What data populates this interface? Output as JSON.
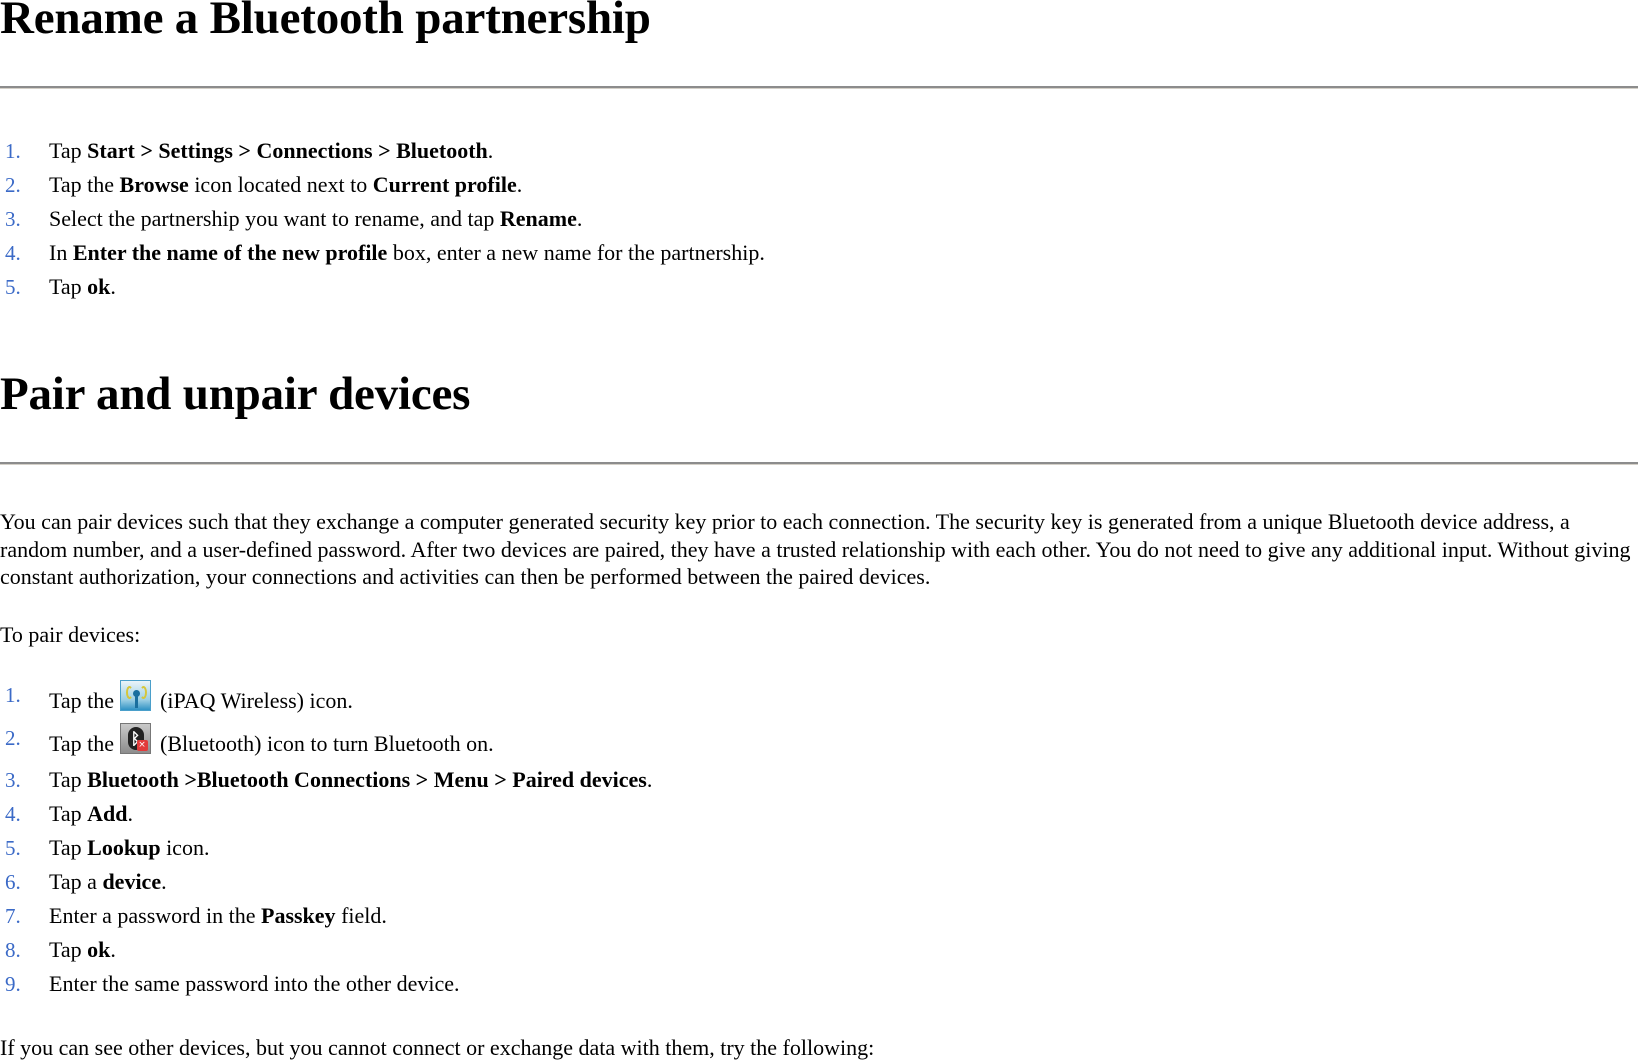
{
  "section1": {
    "title": "Rename a Bluetooth partnership",
    "steps": [
      {
        "num": "1.",
        "parts": [
          "Tap ",
          "Start > Settings > Connections > Bluetooth",
          "."
        ]
      },
      {
        "num": "2.",
        "parts": [
          "Tap the ",
          "Browse",
          " icon located next to ",
          "Current profile",
          "."
        ]
      },
      {
        "num": "3.",
        "parts": [
          "Select the partnership you want to rename, and tap ",
          "Rename",
          "."
        ]
      },
      {
        "num": "4.",
        "parts": [
          "In ",
          "Enter the name of the new profile",
          " box, enter a new name for the partnership."
        ]
      },
      {
        "num": "5.",
        "parts": [
          "Tap ",
          "ok",
          "."
        ]
      }
    ]
  },
  "section2": {
    "title": "Pair and unpair devices",
    "intro": "You can pair devices such that they exchange a computer generated security key prior to each connection. The security key is generated from a unique Bluetooth device address, a random number, and a user-defined password. After two devices are paired, they have a trusted relationship with each other. You do not need to give any additional input. Without giving constant authorization, your connections and activities can then be performed between the paired devices.",
    "to_pair": "To pair devices:",
    "steps": [
      {
        "num": "1.",
        "before": "Tap the ",
        "icon": "ipaq-wireless-icon",
        "after": " (iPAQ Wireless) icon."
      },
      {
        "num": "2.",
        "before": "Tap the ",
        "icon": "bluetooth-icon",
        "after": " (Bluetooth) icon to turn Bluetooth on."
      },
      {
        "num": "3.",
        "parts": [
          "Tap ",
          "Bluetooth >Bluetooth Connections > Menu > Paired devices",
          "."
        ]
      },
      {
        "num": "4.",
        "parts": [
          "Tap ",
          "Add",
          "."
        ]
      },
      {
        "num": "5.",
        "parts": [
          "Tap ",
          "Lookup",
          " icon."
        ]
      },
      {
        "num": "6.",
        "parts": [
          "Tap a ",
          "device",
          "."
        ]
      },
      {
        "num": "7.",
        "parts": [
          "Enter a password in the ",
          "Passkey",
          " field."
        ]
      },
      {
        "num": "8.",
        "parts": [
          "Tap ",
          "ok",
          "."
        ]
      },
      {
        "num": "9.",
        "parts": [
          "Enter the same password into the other device."
        ]
      }
    ],
    "trailing": "If you can see other devices, but you cannot connect or exchange data with them, try the following:"
  },
  "colors": {
    "list_number": "#3b6ac7",
    "rule_dark": "#8c8c8c",
    "rule_light": "#d4d0c8"
  }
}
